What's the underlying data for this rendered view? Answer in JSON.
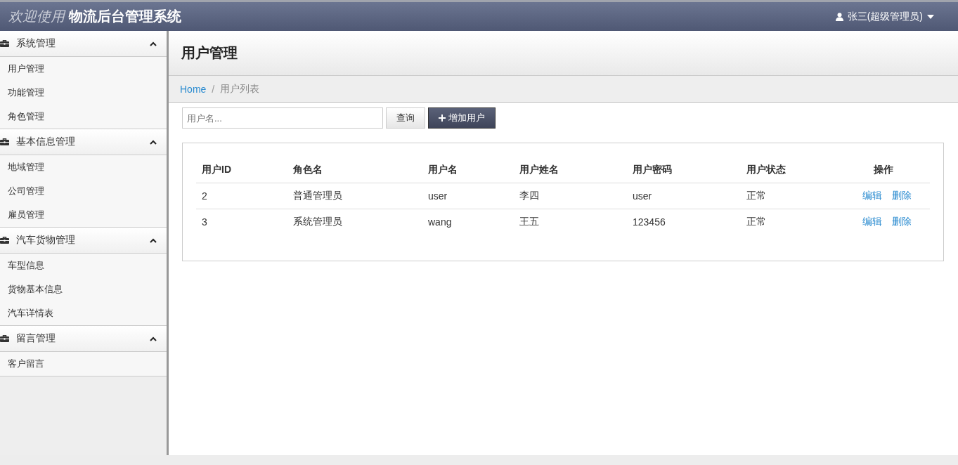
{
  "header": {
    "welcome": "欢迎使用",
    "title": "物流后台管理系统",
    "user": "张三(超级管理员)"
  },
  "sidebar": {
    "groups": [
      {
        "label": "系统管理",
        "expanded": true,
        "items": [
          "用户管理",
          "功能管理",
          "角色管理"
        ]
      },
      {
        "label": "基本信息管理",
        "expanded": true,
        "items": [
          "地域管理",
          "公司管理",
          "雇员管理"
        ]
      },
      {
        "label": "汽车货物管理",
        "expanded": true,
        "items": [
          "车型信息",
          "货物基本信息",
          "汽车详情表"
        ]
      },
      {
        "label": "留言管理",
        "expanded": true,
        "items": [
          "客户留言"
        ]
      }
    ]
  },
  "page_title": "用户管理",
  "breadcrumb": {
    "home": "Home",
    "separator": "/",
    "current": "用户列表"
  },
  "search": {
    "placeholder": "用户名...",
    "query_button": "查询",
    "add_button": "增加用户"
  },
  "table": {
    "columns": [
      "用户ID",
      "角色名",
      "用户名",
      "用户姓名",
      "用户密码",
      "用户状态",
      "操作"
    ],
    "rows": [
      {
        "cells": [
          "2",
          "普通管理员",
          "user",
          "李四",
          "user",
          "正常"
        ],
        "actions": [
          "编辑",
          "删除"
        ]
      },
      {
        "cells": [
          "3",
          "系统管理员",
          "wang",
          "王五",
          "123456",
          "正常"
        ],
        "actions": [
          "编辑",
          "删除"
        ]
      }
    ]
  }
}
